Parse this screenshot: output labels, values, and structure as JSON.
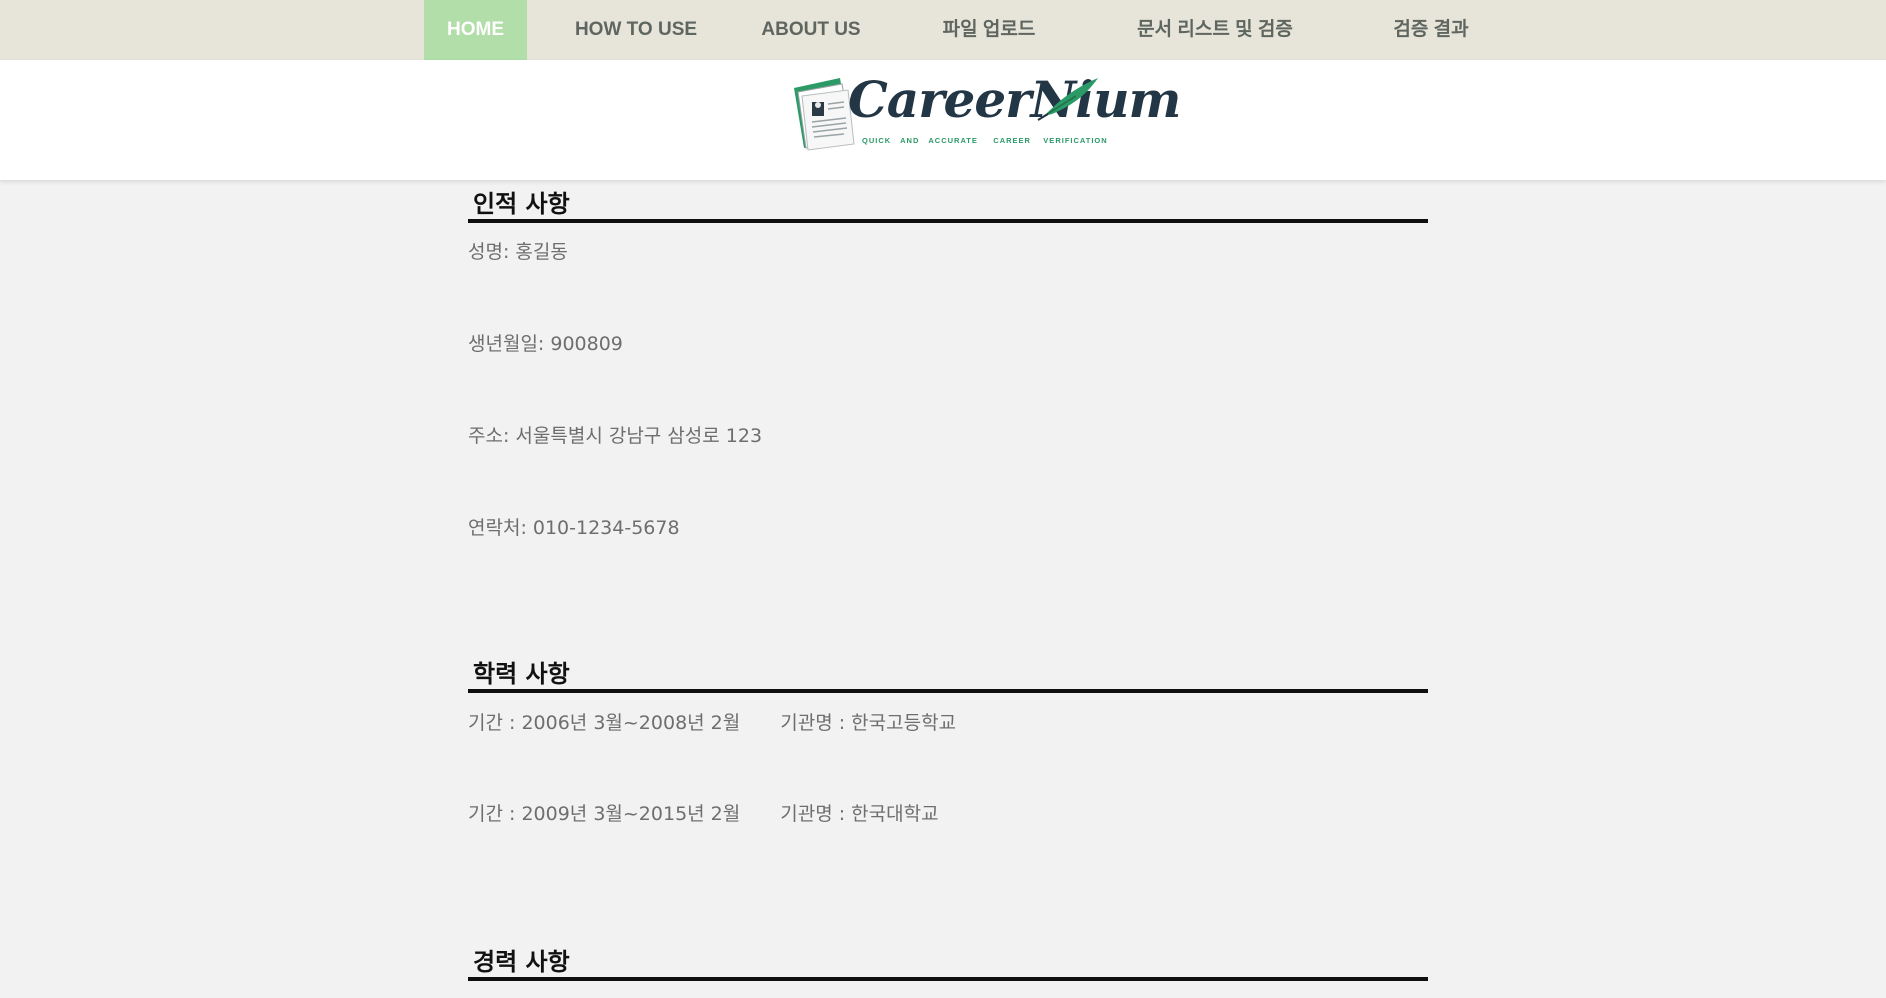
{
  "nav": {
    "items": [
      {
        "label": "HOME",
        "active": true
      },
      {
        "label": "HOW TO USE",
        "active": false
      },
      {
        "label": "ABOUT US",
        "active": false
      },
      {
        "label": "파일 업로드",
        "active": false
      },
      {
        "label": "문서 리스트 및 검증",
        "active": false
      },
      {
        "label": "검증 결과",
        "active": false
      }
    ]
  },
  "logo": {
    "text": "CareerNium",
    "tagline": "QUICK   AND   ACCURATE     CAREER    VERIFICATION"
  },
  "personal": {
    "title": "인적 사항",
    "fields": [
      "성명: 홍길동",
      "생년월일: 900809",
      "주소: 서울특별시 강남구 삼성로 123",
      "연락처: 010-1234-5678"
    ]
  },
  "education": {
    "title": "학력 사항",
    "entries": [
      {
        "period": "기간 : 2006년 3월~2008년 2월",
        "institution": "기관명 : 한국고등학교"
      },
      {
        "period": "기간 : 2009년 3월~2015년 2월",
        "institution": "기관명 : 한국대학교"
      }
    ]
  },
  "career": {
    "title": "경력 사항"
  },
  "colors": {
    "nav_bg": "#e7e5da",
    "nav_active": "#b1dea9",
    "page_bg": "#f1f2f1",
    "logo_text": "#223645",
    "logo_accent": "#2b9a67"
  }
}
